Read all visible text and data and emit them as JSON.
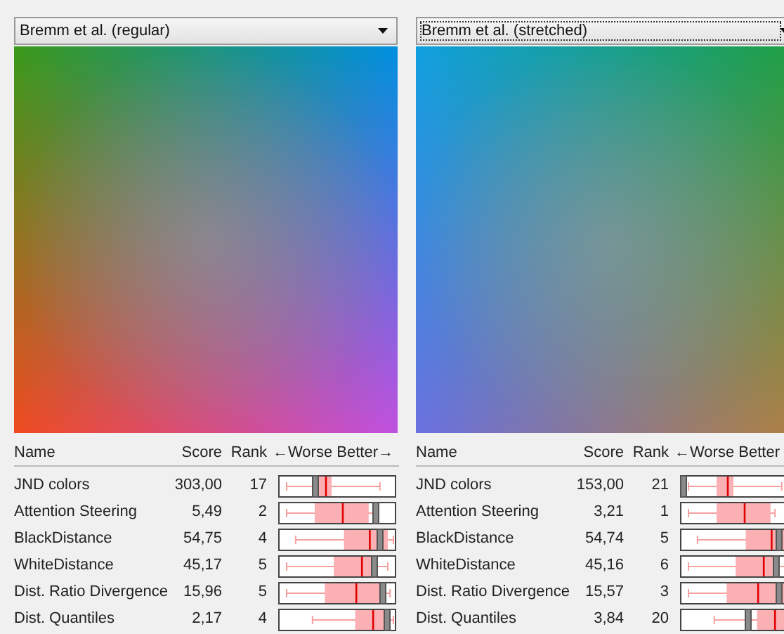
{
  "panels": [
    {
      "dropdown": {
        "value": "Bremm et al. (regular)",
        "focused": false
      },
      "kind": "regular",
      "columns": {
        "name": "Name",
        "score": "Score",
        "rank": "Rank",
        "scale": "←Worse Better→"
      },
      "rows": [
        {
          "name": "JND colors",
          "score": "303,00",
          "rank": "17",
          "level": 0.32
        },
        {
          "name": "Attention Steering",
          "score": "5,49",
          "rank": "2",
          "level": 0.84
        },
        {
          "name": "BlackDistance",
          "score": "54,75",
          "rank": "4",
          "level": 0.88
        },
        {
          "name": "WhiteDistance",
          "score": "45,17",
          "rank": "5",
          "level": 0.83
        },
        {
          "name": "Dist. Ratio Divergence",
          "score": "15,96",
          "rank": "5",
          "level": 0.9
        },
        {
          "name": "Dist. Quantiles",
          "score": "2,17",
          "rank": "4",
          "level": 0.94
        }
      ]
    },
    {
      "dropdown": {
        "value": "Bremm et al. (stretched)",
        "focused": true
      },
      "kind": "stretched",
      "columns": {
        "name": "Name",
        "score": "Score",
        "rank": "Rank",
        "scale": "←Worse Better"
      },
      "rows": [
        {
          "name": "JND colors",
          "score": "153,00",
          "rank": "21",
          "level": 0.03
        },
        {
          "name": "Attention Steering",
          "score": "3,21",
          "rank": "1"
        },
        {
          "name": "BlackDistance",
          "score": "54,74",
          "rank": "5",
          "level": 0.85
        },
        {
          "name": "WhiteDistance",
          "score": "45,16",
          "rank": "6",
          "level": 0.83
        },
        {
          "name": "Dist. Ratio Divergence",
          "score": "15,57",
          "rank": "3",
          "level": 0.85
        },
        {
          "name": "Dist. Quantiles",
          "score": "3,84",
          "rank": "20",
          "level": 0.58
        }
      ]
    }
  ]
}
